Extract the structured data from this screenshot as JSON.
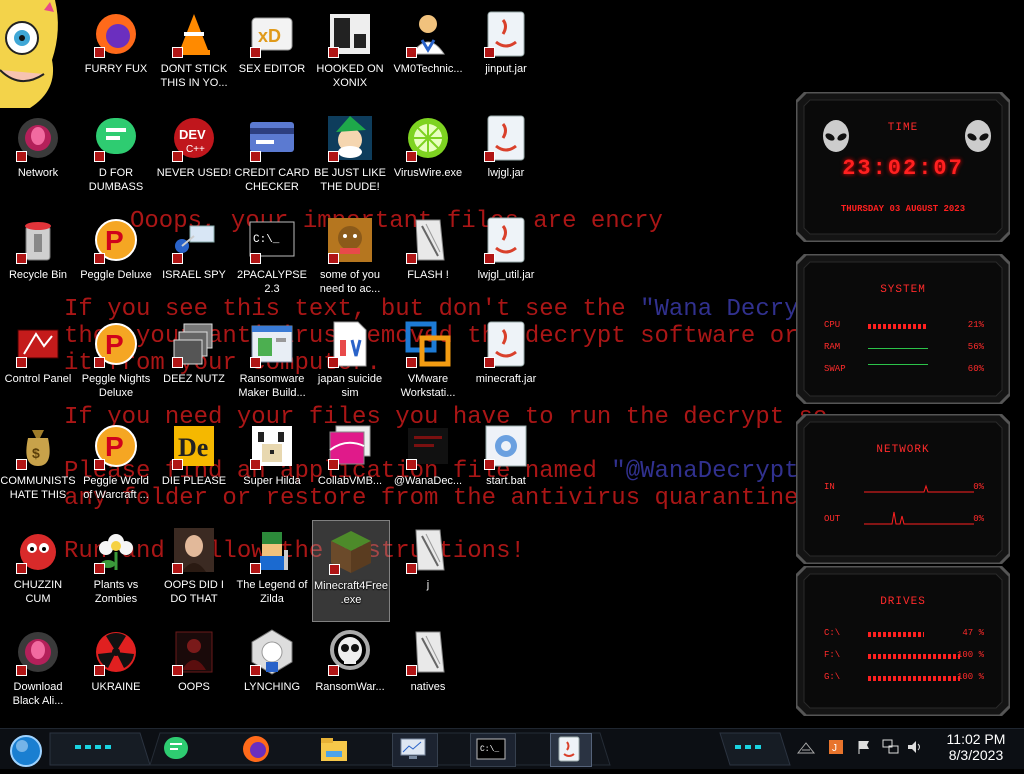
{
  "wallpaper_text": {
    "line1": "Ooops, your important files are encry",
    "line2a": "If you see this text, but don't see the ",
    "line2b": "\"Wana Decrypto",
    "line3": "then your antivirus removed the decrypt software or",
    "line4": "it from your computer.",
    "line5": "If you need your files you have to run the decrypt so",
    "line6a": "Please find an application file named ",
    "line6b": "\"@WanaDecrypto",
    "line7": "any folder or restore from the antivirus quarantine.",
    "line8": "Run and follow the instructions!"
  },
  "desktop_icons": [
    {
      "label": "FURRY FUX",
      "icon": "firefox-icon"
    },
    {
      "label": "DONT STICK THIS IN YO...",
      "icon": "vlc-cone-icon"
    },
    {
      "label": "SEX EDITOR",
      "icon": "hex-editor-icon"
    },
    {
      "label": "HOOKED ON XONIX",
      "icon": "xonix-game-icon"
    },
    {
      "label": "VM0Technic...",
      "icon": "doctor-icon"
    },
    {
      "label": "jinput.jar",
      "icon": "java-jar-icon"
    },
    {
      "label": "Network",
      "icon": "alien-network-icon"
    },
    {
      "label": "D FOR DUMBASS",
      "icon": "chat-bubble-icon"
    },
    {
      "label": "NEVER USED!",
      "icon": "dev-cpp-icon"
    },
    {
      "label": "CREDIT CARD CHECKER",
      "icon": "credit-card-icon"
    },
    {
      "label": "BE JUST LIKE THE DUDE!",
      "icon": "elf-icon"
    },
    {
      "label": "VirusWire.exe",
      "icon": "lime-icon"
    },
    {
      "label": "lwjgl.jar",
      "icon": "java-jar-icon"
    },
    {
      "label": "Recycle Bin",
      "icon": "recycle-bin-icon"
    },
    {
      "label": "Peggle Deluxe",
      "icon": "peggle-icon"
    },
    {
      "label": "ISRAEL SPY",
      "icon": "spy-network-icon"
    },
    {
      "label": "2PACALYPSE 2.3",
      "icon": "terminal-icon"
    },
    {
      "label": "some of you need to ac...",
      "icon": "dog-icon"
    },
    {
      "label": "FLASH !",
      "icon": "shortcut-file-icon"
    },
    {
      "label": "lwjgl_util.jar",
      "icon": "java-jar-icon"
    },
    {
      "label": "Control Panel",
      "icon": "control-panel-icon"
    },
    {
      "label": "Peggle Nights Deluxe",
      "icon": "peggle-icon"
    },
    {
      "label": "DEEZ NUTZ",
      "icon": "windows-stack-icon"
    },
    {
      "label": "Ransomware Maker Build...",
      "icon": "app-window-icon"
    },
    {
      "label": "japan suicide sim",
      "icon": "document-icon"
    },
    {
      "label": "VMware Workstati...",
      "icon": "vmware-icon"
    },
    {
      "label": "minecraft.jar",
      "icon": "java-jar-icon"
    },
    {
      "label": "COMMUNISTS HATE THIS G...",
      "icon": "money-bag-icon"
    },
    {
      "label": "Peggle World of Warcraft ...",
      "icon": "peggle-icon"
    },
    {
      "label": "DIE PLEASE",
      "icon": "de-logo-icon"
    },
    {
      "label": "Super Hilda",
      "icon": "pixel-dog-icon"
    },
    {
      "label": "CollabVMB...",
      "icon": "pink-screen-icon"
    },
    {
      "label": "@WanaDec...",
      "icon": "wannacry-icon"
    },
    {
      "label": "start.bat",
      "icon": "batch-gear-icon"
    },
    {
      "label": "CHUZZIN CUM",
      "icon": "chuzzle-icon"
    },
    {
      "label": "Plants vs Zombies",
      "icon": "flower-icon"
    },
    {
      "label": "OOPS DID I DO THAT",
      "icon": "portrait-icon"
    },
    {
      "label": "The Legend of Zilda",
      "icon": "pixel-hero-icon"
    },
    {
      "label": "Minecraft4Free .exe",
      "icon": "grass-block-icon"
    },
    {
      "label": "j",
      "icon": "shortcut-file-icon"
    },
    {
      "label": "Download Black Ali...",
      "icon": "alien-network-icon"
    },
    {
      "label": "UKRAINE",
      "icon": "radiation-icon"
    },
    {
      "label": "OOPS",
      "icon": "dark-figure-icon"
    },
    {
      "label": "LYNCHING",
      "icon": "emblem-icon"
    },
    {
      "label": "RansomWar...",
      "icon": "skull-icon"
    },
    {
      "label": "natives",
      "icon": "shortcut-file-icon"
    }
  ],
  "gadgets": {
    "time": {
      "title": "TIME",
      "clock": "23:02:07",
      "date": "THURSDAY 03 AUGUST 2023"
    },
    "system": {
      "title": "SYSTEM",
      "rows": [
        {
          "label": "CPU",
          "value": "21%",
          "level": 0.21
        },
        {
          "label": "RAM",
          "value": "56%",
          "level": 0.56
        },
        {
          "label": "SWAP",
          "value": "60%",
          "level": 0.6
        }
      ]
    },
    "network": {
      "title": "NETWORK",
      "rows": [
        {
          "label": "IN",
          "value": "0%"
        },
        {
          "label": "OUT",
          "value": "0%"
        }
      ]
    },
    "drives": {
      "title": "DRIVES",
      "rows": [
        {
          "label": "C:\\",
          "value": "47 %",
          "level": 0.47
        },
        {
          "label": "F:\\",
          "value": "100 %",
          "level": 1.0
        },
        {
          "label": "G:\\",
          "value": "100 %",
          "level": 1.0
        }
      ]
    }
  },
  "taskbar": {
    "start_icon": "start-orb-icon",
    "pinned": [
      "chat-bubble-icon",
      "firefox-icon",
      "file-explorer-icon",
      "monitor-icon",
      "terminal-icon",
      "java-jar-icon"
    ],
    "tray_icons": [
      "keyboard-icon",
      "java-update-icon",
      "flag-icon",
      "network-icon",
      "volume-icon"
    ],
    "time": "11:02 PM",
    "date": "8/3/2023"
  },
  "colors": {
    "accent": "#ff2020",
    "wall_text": "#c81a1a",
    "wall_highlight": "#3a3aa8",
    "taskbar": "#0c0f14",
    "glow": "#19d3e0"
  }
}
